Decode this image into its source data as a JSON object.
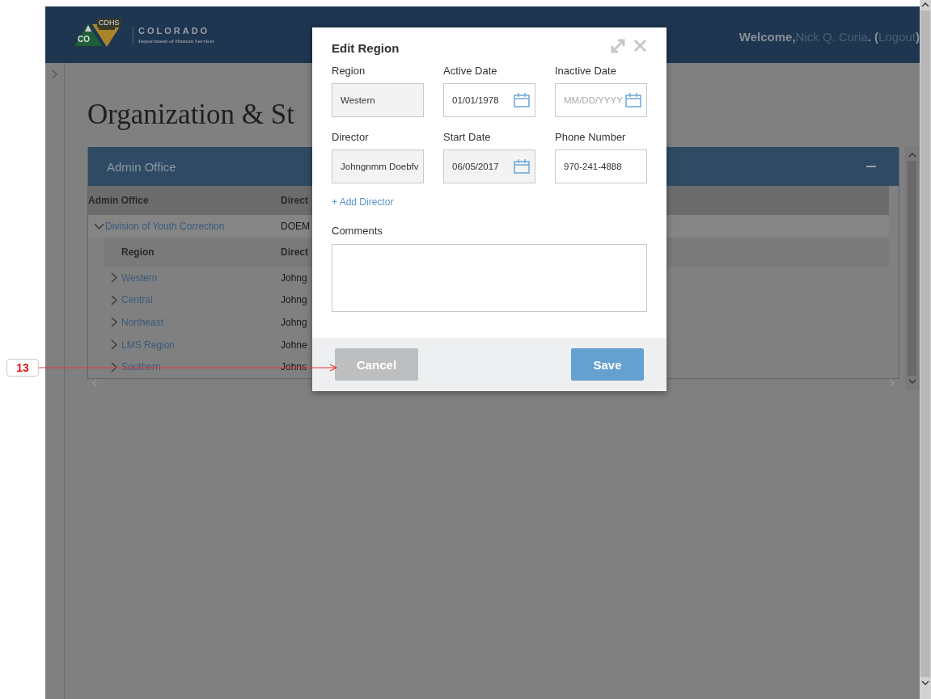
{
  "header": {
    "logo_badge": "CDHS",
    "logo_mark": "CO",
    "org_name": "COLORADO",
    "org_subtitle": "Department of Human Services",
    "welcome": "Welcome,",
    "user_name": "Nick Q. Curia",
    "separator": ". (",
    "logout": "Logout",
    "close_paren": ")"
  },
  "page_title": "Organization & St",
  "panel": {
    "title": "Admin Office"
  },
  "table": {
    "columns": [
      "Admin Office",
      "Direct"
    ],
    "rows": [
      {
        "name": "Division of Youth Correction",
        "director": "DOEM",
        "expanded": true,
        "child_columns": [
          "Region",
          "Direct"
        ],
        "children": [
          {
            "name": "Western",
            "director": "Johng",
            "expanded": false
          },
          {
            "name": "Central",
            "director": "Johng",
            "expanded": false
          },
          {
            "name": "Northeast",
            "director": "Johng",
            "expanded": false
          },
          {
            "name": "LMS Region",
            "director": "Johne",
            "expanded": false
          },
          {
            "name": "Southern",
            "director": "Johns",
            "expanded": false
          }
        ]
      }
    ]
  },
  "modal": {
    "title": "Edit Region",
    "fields": [
      {
        "label": "Region",
        "kind": "text",
        "value": "Western",
        "disabled": true
      },
      {
        "label": "Active Date",
        "kind": "date",
        "value": "01/01/1978",
        "disabled": false
      },
      {
        "label": "Inactive Date",
        "kind": "date",
        "placeholder": "MM/DD/YYYY",
        "disabled": false
      },
      {
        "label": "Director",
        "kind": "text",
        "value": "Johngnmm Doebfv",
        "disabled": true
      },
      {
        "label": "Start Date",
        "kind": "date",
        "value": "06/05/2017",
        "disabled": true
      },
      {
        "label": "Phone Number",
        "kind": "text",
        "value": "970-241-4888",
        "disabled": false
      }
    ],
    "add_link": "+ Add Director",
    "comments": {
      "label": "Comments"
    },
    "buttons": [
      {
        "label": "Cancel",
        "kind": "secondary",
        "disabled": true
      },
      {
        "label": "Save",
        "kind": "primary",
        "disabled": false
      }
    ]
  },
  "callout": {
    "label": "13"
  }
}
